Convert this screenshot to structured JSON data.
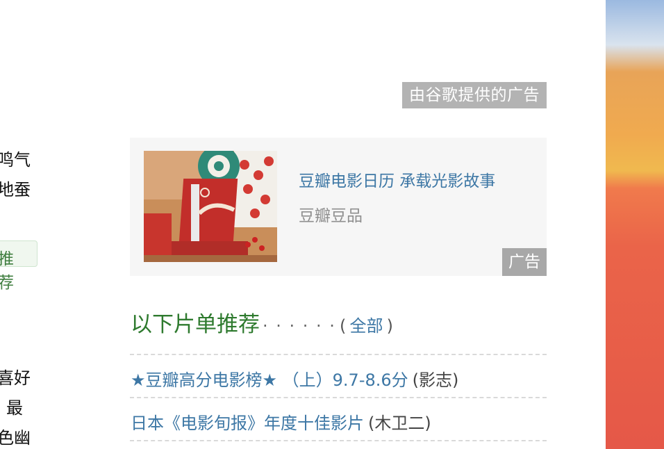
{
  "left_fragments": [
    "鸣气",
    "地蚕",
    "喜好",
    "最",
    "色幽"
  ],
  "left_tag": "推荐",
  "google_ad_label": "由谷歌提供的广告",
  "ad": {
    "title": "豆瓣电影日历 承载光影故事",
    "subtitle": "豆瓣豆品",
    "badge": "广告",
    "image_icon": "calendar-product-photo"
  },
  "doulist": {
    "title": "以下片单推荐",
    "dots": "· · · · · ·",
    "paren_open": "(",
    "all_link": "全部",
    "paren_close": ")",
    "items": [
      {
        "title": "★豆瓣高分电影榜★ （上）9.7-8.6分",
        "author": "(影志)"
      },
      {
        "title": "日本《电影旬报》年度十佳影片",
        "author": "(木卫二)"
      }
    ]
  }
}
